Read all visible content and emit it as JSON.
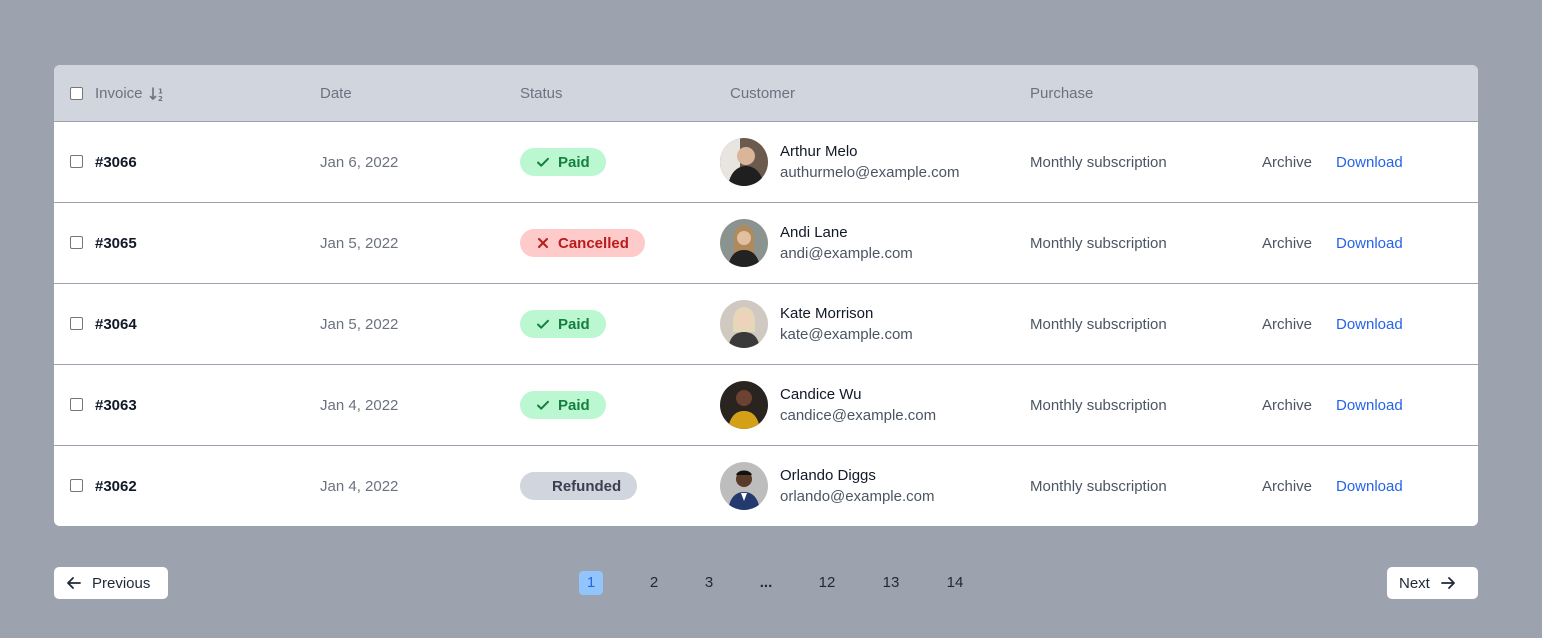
{
  "table": {
    "headers": {
      "invoice": "Invoice",
      "date": "Date",
      "status": "Status",
      "customer": "Customer",
      "purchase": "Purchase"
    },
    "rows": [
      {
        "invoice": "#3066",
        "date": "Jan 6, 2022",
        "status": "Paid",
        "status_type": "paid",
        "name": "Arthur Melo",
        "email": "authurmelo@example.com",
        "purchase": "Monthly subscription",
        "archive": "Archive",
        "download": "Download"
      },
      {
        "invoice": "#3065",
        "date": "Jan 5, 2022",
        "status": "Cancelled",
        "status_type": "cancelled",
        "name": "Andi Lane",
        "email": "andi@example.com",
        "purchase": "Monthly subscription",
        "archive": "Archive",
        "download": "Download"
      },
      {
        "invoice": "#3064",
        "date": "Jan 5, 2022",
        "status": "Paid",
        "status_type": "paid",
        "name": "Kate Morrison",
        "email": "kate@example.com",
        "purchase": "Monthly subscription",
        "archive": "Archive",
        "download": "Download"
      },
      {
        "invoice": "#3063",
        "date": "Jan 4, 2022",
        "status": "Paid",
        "status_type": "paid",
        "name": "Candice Wu",
        "email": "candice@example.com",
        "purchase": "Monthly subscription",
        "archive": "Archive",
        "download": "Download"
      },
      {
        "invoice": "#3062",
        "date": "Jan 4, 2022",
        "status": "Refunded",
        "status_type": "refunded",
        "name": "Orlando Diggs",
        "email": "orlando@example.com",
        "purchase": "Monthly subscription",
        "archive": "Archive",
        "download": "Download"
      }
    ]
  },
  "pagination": {
    "previous": "Previous",
    "next": "Next",
    "pages": [
      "1",
      "2",
      "3",
      "...",
      "12",
      "13",
      "14"
    ],
    "current": "1"
  },
  "colors": {
    "page_bg": "#9ca2ae",
    "header_bg": "#d1d5dd",
    "link": "#2563eb",
    "paid_bg": "#bbf7d0",
    "paid_fg": "#15803d",
    "cancelled_bg": "#fecaca",
    "cancelled_fg": "#b91c1c",
    "refunded_bg": "#d1d5dd"
  },
  "icons": {
    "sort": "sort-numeric-icon",
    "paid": "check-icon",
    "cancelled": "x-icon",
    "previous": "arrow-left-icon",
    "next": "arrow-right-icon"
  }
}
